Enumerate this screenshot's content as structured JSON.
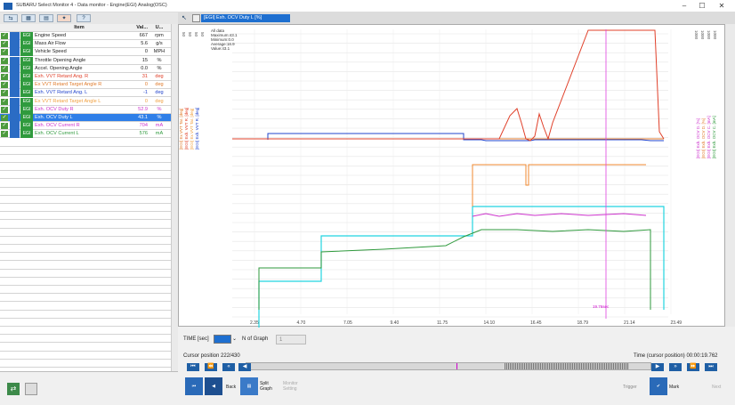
{
  "window": {
    "title": "SUBARU Select Monitor 4 - Data monitor - Engine(EGI) Analog(OSC)",
    "min": "–",
    "max": "☐",
    "close": "✕"
  },
  "toolbar": {
    "help": "?"
  },
  "grid": {
    "headers": {
      "item": "Item",
      "value": "Val...",
      "unit": "U..."
    },
    "rows": [
      {
        "sys": "EGI",
        "name": "Engine Speed",
        "value": "667",
        "unit": "rpm",
        "color": "#222222"
      },
      {
        "sys": "EGI",
        "name": "Mass Air Flow",
        "value": "5.6",
        "unit": "g/s",
        "color": "#222222"
      },
      {
        "sys": "EGI",
        "name": "Vehicle Speed",
        "value": "0",
        "unit": "MPH",
        "color": "#222222"
      },
      {
        "sys": "EGI",
        "name": "Throttle Opening Angle",
        "value": "15",
        "unit": "%",
        "color": "#222222"
      },
      {
        "sys": "EGI",
        "name": "Accel. Opening Angle",
        "value": "0.0",
        "unit": "%",
        "color": "#222222"
      },
      {
        "sys": "EGI",
        "name": "Exh. VVT Retard Ang. R",
        "value": "31",
        "unit": "deg",
        "color": "#e0402a"
      },
      {
        "sys": "EGI",
        "name": "Ex VVT Retard Target Angle R",
        "value": "0",
        "unit": "deg",
        "color": "#e07a2a"
      },
      {
        "sys": "EGI",
        "name": "Exh. VVT Retard Ang. L",
        "value": "-1",
        "unit": "deg",
        "color": "#2244cc"
      },
      {
        "sys": "EGI",
        "name": "Ex VVT Retard Target Angle L",
        "value": "0",
        "unit": "deg",
        "color": "#f0a040"
      },
      {
        "sys": "EGI",
        "name": "Exh. OCV Duty R",
        "value": "52.9",
        "unit": "%",
        "color": "#cc33cc"
      },
      {
        "sys": "EGI",
        "name": "Exh. OCV Duty L",
        "value": "43.1",
        "unit": "%",
        "color": "#ffffff",
        "selected": true
      },
      {
        "sys": "EGI",
        "name": "Exh. OCV Current R",
        "value": "704",
        "unit": "mA",
        "color": "#cc33cc"
      },
      {
        "sys": "EGI",
        "name": "Exh. OCV Current L",
        "value": "576",
        "unit": "mA",
        "color": "#2f9a3d"
      }
    ]
  },
  "graph": {
    "tab_label": "[EGI] Exh. OCV Duty L [%]",
    "stats": [
      "All data",
      "Maximum:43.1",
      "Minimum:0.0",
      "Average:18.9",
      "Value:43.1"
    ],
    "x_ticks": [
      "2.35",
      "4.70",
      "7.05",
      "9.40",
      "11.75",
      "14.10",
      "16.45",
      "18.79",
      "21.14",
      "23.49"
    ],
    "cursor_label": "19.76sec",
    "axis_labels_left": [
      "[EGI] Ex VVT Tar. [deg]",
      "[EGI] Exh. VVT R. [deg]",
      "[EGI] Ex VVT Tar. [deg]",
      "[EGI] Exh. VVT R. [deg]"
    ],
    "axis_labels_right": [
      "[EGI] Exh. OCV D. [%]",
      "[EGI] Exh. OCV D. [%]",
      "[EGI] Exh. OCV C. [mA]",
      "[EGI] Exh. OCV C. [mA]"
    ],
    "top_right_ticks": [
      "1000",
      "1000",
      "1000",
      "1000"
    ],
    "left_ticks": [
      "50",
      "50",
      "50",
      "50"
    ]
  },
  "time": {
    "label": "TIME [sec]",
    "graph_count_label": "N of Graph",
    "graph_count": "1"
  },
  "cursor": {
    "position": "Cursor position 222/430",
    "time": "Time (cursor position) 00:00:19.762"
  },
  "bottom": {
    "back": "Back",
    "split": "Split Graph",
    "monitor": "Monitor Setting",
    "trigger": "Trigger",
    "mark": "Mark",
    "next": "Next"
  }
}
